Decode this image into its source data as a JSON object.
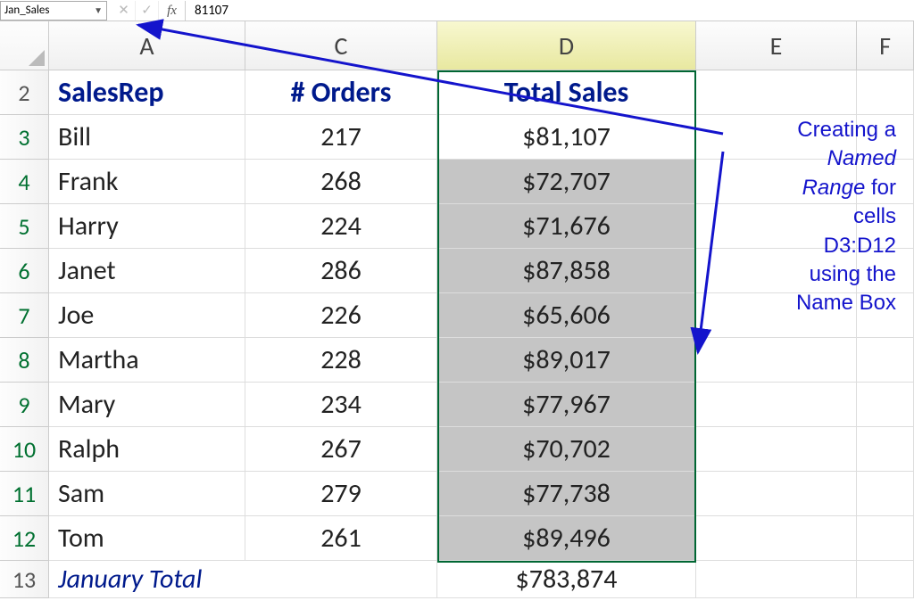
{
  "formula_bar": {
    "name_box_value": "Jan_Sales",
    "cancel_glyph": "✕",
    "confirm_glyph": "✓",
    "fx_label": "fx",
    "formula_value": "81107"
  },
  "columns": [
    "A",
    "C",
    "D",
    "E",
    "F"
  ],
  "selected_column": "D",
  "headers": {
    "salesrep": "SalesRep",
    "orders": "# Orders",
    "total_sales": "Total Sales"
  },
  "rows": [
    {
      "num": "3",
      "name": "Bill",
      "orders": "217",
      "sales": "$81,107"
    },
    {
      "num": "4",
      "name": "Frank",
      "orders": "268",
      "sales": "$72,707"
    },
    {
      "num": "5",
      "name": "Harry",
      "orders": "224",
      "sales": "$71,676"
    },
    {
      "num": "6",
      "name": "Janet",
      "orders": "286",
      "sales": "$87,858"
    },
    {
      "num": "7",
      "name": "Joe",
      "orders": "226",
      "sales": "$65,606"
    },
    {
      "num": "8",
      "name": "Martha",
      "orders": "228",
      "sales": "$89,017"
    },
    {
      "num": "9",
      "name": "Mary",
      "orders": "234",
      "sales": "$77,967"
    },
    {
      "num": "10",
      "name": "Ralph",
      "orders": "267",
      "sales": "$70,702"
    },
    {
      "num": "11",
      "name": "Sam",
      "orders": "279",
      "sales": "$77,738"
    },
    {
      "num": "12",
      "name": "Tom",
      "orders": "261",
      "sales": "$89,496"
    }
  ],
  "total_row": {
    "num": "13",
    "label": "January Total",
    "sum": "$783,874"
  },
  "header_row_num": "2",
  "annotation": {
    "line1": "Creating a",
    "named": "Named",
    "range": "Range",
    "for_word": " for",
    "line3": "cells",
    "line4": "D3:D12",
    "line5": "using the",
    "line6": "Name Box"
  },
  "chart_data": {
    "type": "table",
    "title": "January Sales by SalesRep",
    "columns": [
      "SalesRep",
      "# Orders",
      "Total Sales"
    ],
    "rows": [
      [
        "Bill",
        217,
        81107
      ],
      [
        "Frank",
        268,
        72707
      ],
      [
        "Harry",
        224,
        71676
      ],
      [
        "Janet",
        286,
        87858
      ],
      [
        "Joe",
        226,
        65606
      ],
      [
        "Martha",
        228,
        89017
      ],
      [
        "Mary",
        234,
        77967
      ],
      [
        "Ralph",
        267,
        70702
      ],
      [
        "Sam",
        279,
        77738
      ],
      [
        "Tom",
        261,
        89496
      ]
    ],
    "total": [
      "January Total",
      null,
      783874
    ],
    "named_range": {
      "name": "Jan_Sales",
      "ref": "D3:D12"
    }
  }
}
